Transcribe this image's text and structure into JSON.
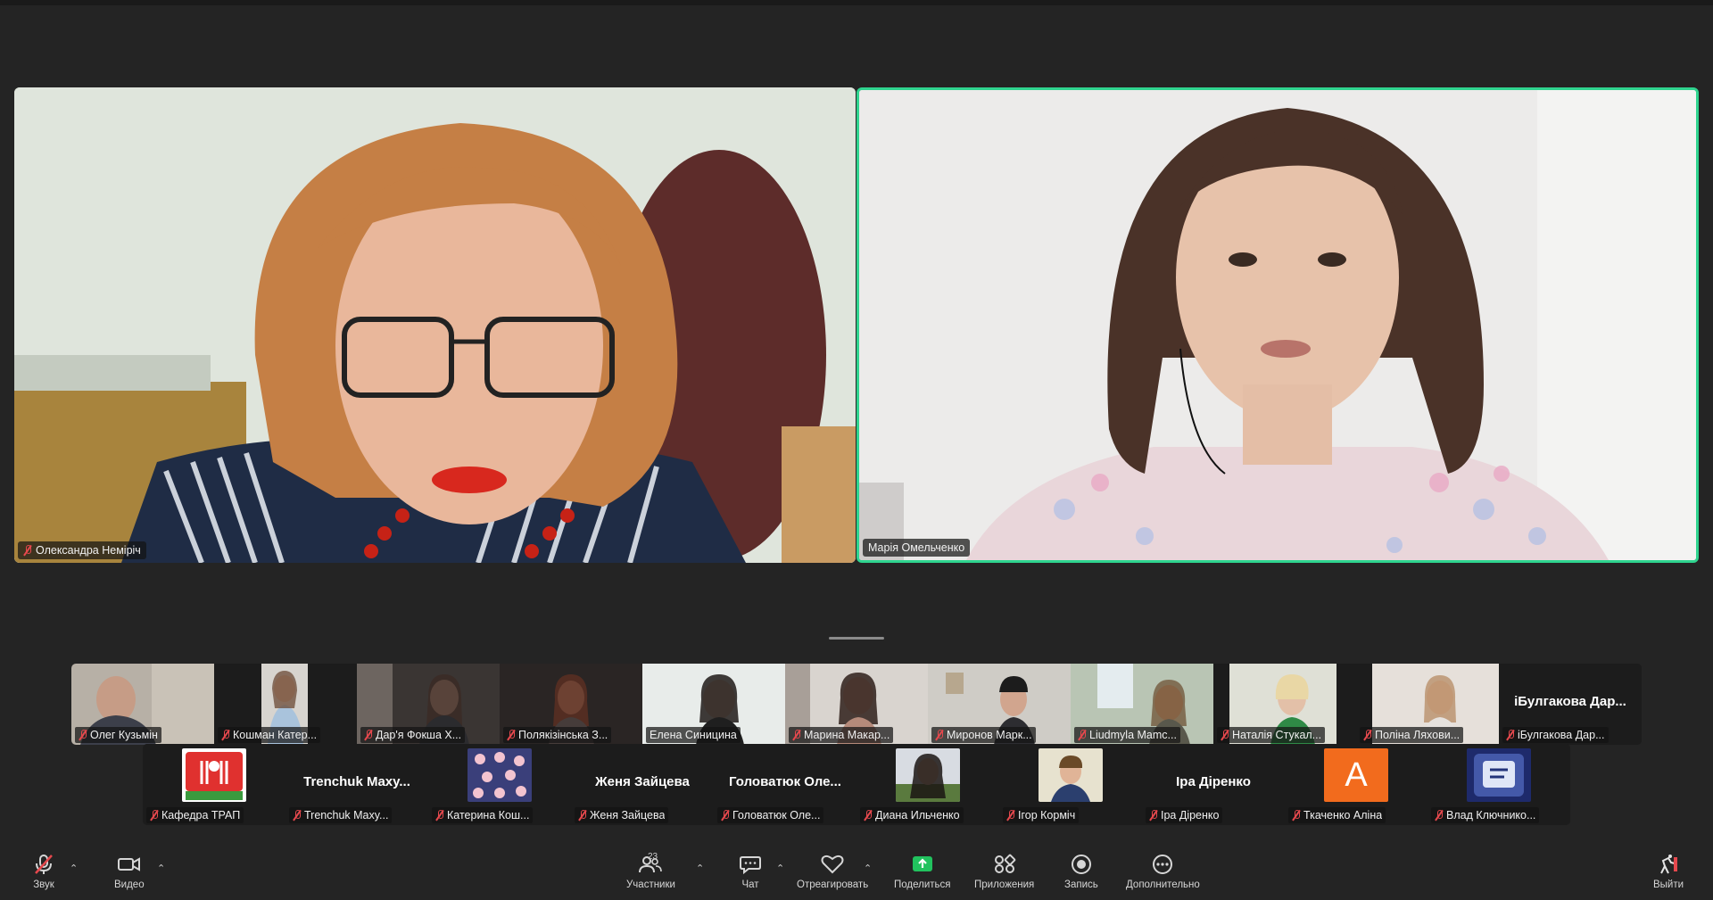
{
  "speakers": [
    {
      "name": "Олександра Неміріч",
      "muted": true
    },
    {
      "name": "Марія Омельченко",
      "muted": false,
      "active": true
    }
  ],
  "gallery_row1": [
    {
      "name": "Олег Кузьмін",
      "muted": true
    },
    {
      "name": "Кошман Катер...",
      "muted": true
    },
    {
      "name": "Дар'я Фокша Х...",
      "muted": true
    },
    {
      "name": "Полякізінська З...",
      "muted": true
    },
    {
      "name": "Елена Синицина",
      "muted": false
    },
    {
      "name": "Марина Макар...",
      "muted": true
    },
    {
      "name": "Миронов Марк...",
      "muted": true
    },
    {
      "name": "Liudmyla Mamc...",
      "muted": true
    },
    {
      "name": "Наталія Стукал...",
      "muted": true
    },
    {
      "name": "Поліна Ляхови...",
      "muted": true
    },
    {
      "name": "іБулгакова Дар...",
      "display": "іБулгакова Дар...",
      "muted": true
    }
  ],
  "gallery_row2": [
    {
      "name": "Кафедра ТРАП",
      "muted": true
    },
    {
      "name": "Trenchuk Maxy...",
      "display": "Trenchuk Maxy...",
      "muted": true
    },
    {
      "name": "Катерина Кош...",
      "muted": true
    },
    {
      "name": "Женя Зайцева",
      "display": "Женя Зайцева",
      "muted": true
    },
    {
      "name": "Головатюк Оле...",
      "display": "Головатюк Оле...",
      "muted": true
    },
    {
      "name": "Диана Ильченко",
      "muted": true
    },
    {
      "name": "Ігор Корміч",
      "muted": true
    },
    {
      "name": "Іра Діренко",
      "display": "Іра Діренко",
      "muted": true
    },
    {
      "name": "Ткаченко Аліна",
      "avatar_letter": "A",
      "muted": true
    },
    {
      "name": "Влад Ключнико...",
      "muted": true
    }
  ],
  "toolbar": {
    "audio": "Звук",
    "video": "Видео",
    "participants": "Участники",
    "participants_count": "23",
    "chat": "Чат",
    "react": "Отреагировать",
    "share": "Поделиться",
    "apps": "Приложения",
    "record": "Запись",
    "more": "Дополнительно",
    "leave": "Выйти"
  },
  "colors": {
    "background": "#242424",
    "active_speaker_border": "#2fd48f",
    "muted_icon": "#e5484d",
    "share_icon": "#21c25e",
    "avatar_orange": "#f26b1d"
  }
}
